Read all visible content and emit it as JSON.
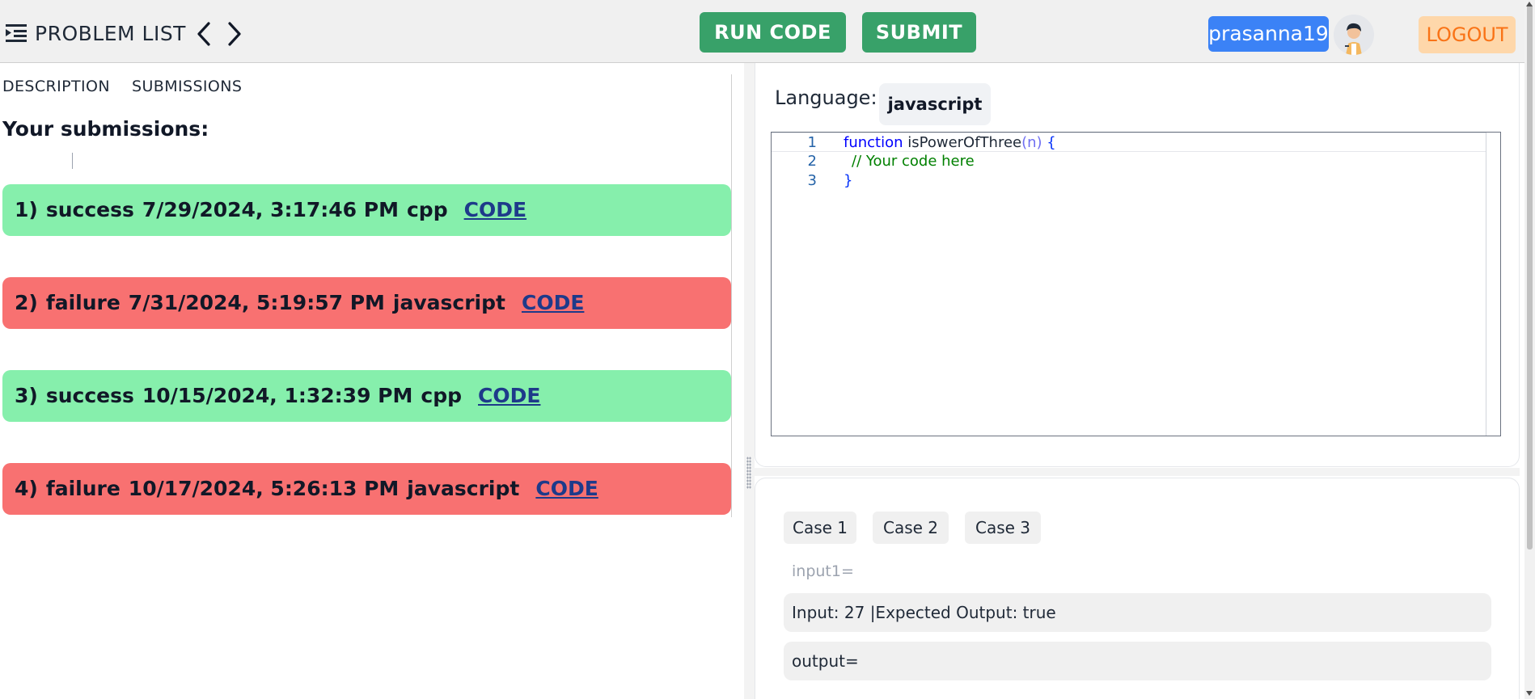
{
  "header": {
    "problem_list_label": "PROBLEM LIST",
    "run_code_label": "RUN CODE",
    "submit_label": "SUBMIT",
    "username": "prasanna19",
    "logout_label": "LOGOUT"
  },
  "left_tabs": {
    "description": "DESCRIPTION",
    "submissions": "SUBMISSIONS"
  },
  "submissions_heading": "Your submissions:",
  "submissions": [
    {
      "index": "1)",
      "status": "success",
      "timestamp": "7/29/2024, 3:17:46 PM",
      "language": "cpp",
      "link": "CODE"
    },
    {
      "index": "2)",
      "status": "failure",
      "timestamp": "7/31/2024, 5:19:57 PM",
      "language": "javascript",
      "link": "CODE"
    },
    {
      "index": "3)",
      "status": "success",
      "timestamp": "10/15/2024, 1:32:39 PM",
      "language": "cpp",
      "link": "CODE"
    },
    {
      "index": "4)",
      "status": "failure",
      "timestamp": "10/17/2024, 5:26:13 PM",
      "language": "javascript",
      "link": "CODE"
    }
  ],
  "editor": {
    "language_label": "Language:",
    "language_value": "javascript",
    "line_numbers": [
      "1",
      "2",
      "3"
    ],
    "code": {
      "keyword": "function",
      "function_name": " isPowerOfThree",
      "param": "(n)",
      "open_brace": " {",
      "comment": "// Your code here",
      "close_brace": "}"
    }
  },
  "tests": {
    "cases": [
      "Case 1",
      "Case 2",
      "Case 3"
    ],
    "input_label": "input1=",
    "input_value": "Input: 27 |Expected Output: true",
    "output_value": "output="
  },
  "colors": {
    "success": "#86efac",
    "failure": "#f87171",
    "primary_green": "#38a169",
    "user_blue": "#3b82f6",
    "logout_bg": "#fed7aa",
    "logout_text": "#f97316",
    "link": "#1e3a8a"
  },
  "icons": {
    "problem_list": "list-indent-icon",
    "prev": "chevron-left-icon",
    "next": "chevron-right-icon",
    "avatar": "user-avatar"
  }
}
